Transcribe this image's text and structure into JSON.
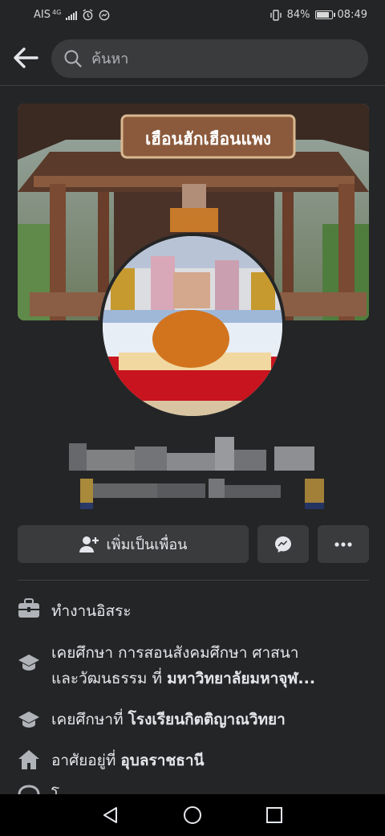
{
  "status_bar": {
    "carrier": "AIS",
    "network": "4G",
    "battery": "84%",
    "battery_level": 0.84,
    "time": "08:49"
  },
  "header": {
    "search_placeholder": "ค้นหา"
  },
  "cover": {
    "sign_text": "เฮือนฮักเฮือนแพง"
  },
  "actions": {
    "add_friend_label": "เพิ่มเป็นเพื่อน"
  },
  "info": {
    "work": "ทำงานอิสระ",
    "edu1_prefix": "เคยศึกษา การสอนสังคมศึกษา ศาสนา",
    "edu1_line2": "และวัฒนธรรม ที่ ",
    "edu1_school": "มหาวิทยาลัยมหาจุฬ...",
    "edu2_prefix": "เคยศึกษาที่ ",
    "edu2_school": "โรงเรียนกิตติญาณวิทยา",
    "home_prefix": "อาศัยอยู่ที่ ",
    "home_place": "อุบลราชธานี",
    "partial": "โ"
  },
  "colors": {
    "background": "#242526",
    "button": "#3a3b3c",
    "text": "#e4e6eb",
    "secondary": "#b0b3b8"
  }
}
